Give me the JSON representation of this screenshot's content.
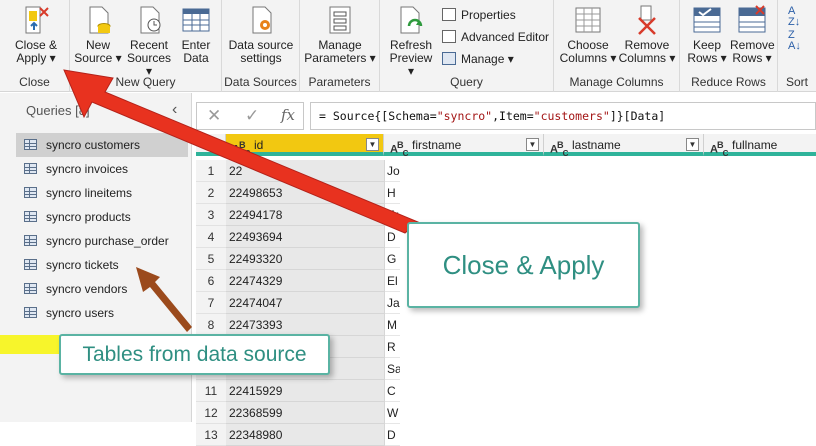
{
  "ribbon": {
    "groups": {
      "close": "Close",
      "new_query": "New Query",
      "data_sources": "Data Sources",
      "parameters": "Parameters",
      "query": "Query",
      "manage_columns": "Manage Columns",
      "reduce_rows": "Reduce Rows",
      "sort": "Sort"
    },
    "buttons": {
      "close_apply": [
        "Close &",
        "Apply ▾"
      ],
      "new_source": [
        "New",
        "Source ▾"
      ],
      "recent_sources": [
        "Recent",
        "Sources ▾"
      ],
      "enter_data": [
        "Enter",
        "Data"
      ],
      "data_source_settings": [
        "Data source",
        "settings"
      ],
      "manage_parameters": [
        "Manage",
        "Parameters ▾"
      ],
      "refresh_preview": [
        "Refresh",
        "Preview ▾"
      ],
      "properties": "Properties",
      "advanced_editor": "Advanced Editor",
      "manage": "Manage ▾",
      "choose_columns": [
        "Choose",
        "Columns ▾"
      ],
      "remove_columns": [
        "Remove",
        "Columns ▾"
      ],
      "keep_rows": [
        "Keep",
        "Rows ▾"
      ],
      "remove_rows": [
        "Remove",
        "Rows ▾"
      ]
    }
  },
  "queries": {
    "header": "Queries [8]",
    "items": [
      "syncro customers",
      "syncro invoices",
      "syncro lineitems",
      "syncro products",
      "syncro purchase_order",
      "syncro tickets",
      "syncro vendors",
      "syncro users"
    ]
  },
  "formula": {
    "fx": "fx",
    "prefix": "= Source{[Schema=",
    "schema": "\"syncro\"",
    "mid": ",Item=",
    "item": "\"customers\"",
    "suffix": "]}[Data]"
  },
  "grid": {
    "columns": [
      "id",
      "firstname",
      "lastname",
      "fullname"
    ],
    "type_badge": "ABC",
    "rows": [
      {
        "n": "1",
        "id": "22",
        "fn": "Jo"
      },
      {
        "n": "2",
        "id": "22498653",
        "fn": "H"
      },
      {
        "n": "3",
        "id": "22494178",
        "fn": "Fr"
      },
      {
        "n": "4",
        "id": "22493694",
        "fn": "D"
      },
      {
        "n": "5",
        "id": "22493320",
        "fn": "G"
      },
      {
        "n": "6",
        "id": "22474329",
        "fn": "El"
      },
      {
        "n": "7",
        "id": "22474047",
        "fn": "Ja"
      },
      {
        "n": "8",
        "id": "22473393",
        "fn": "M"
      },
      {
        "n": "9",
        "id": "",
        "fn": "R"
      },
      {
        "n": "10",
        "id": "",
        "fn": "Sa"
      },
      {
        "n": "11",
        "id": "22415929",
        "fn": "C"
      },
      {
        "n": "12",
        "id": "22368599",
        "fn": "W"
      },
      {
        "n": "13",
        "id": "22348980",
        "fn": "D"
      }
    ]
  },
  "annotations": {
    "close_apply": "Close & Apply",
    "tables": "Tables from data source"
  },
  "colors": {
    "arrow": "#e8321f",
    "active_column": "#f2c811",
    "quality_bar": "#2fb39a",
    "callout_border": "#5ab3a3",
    "highlight": "#f7f52b"
  }
}
